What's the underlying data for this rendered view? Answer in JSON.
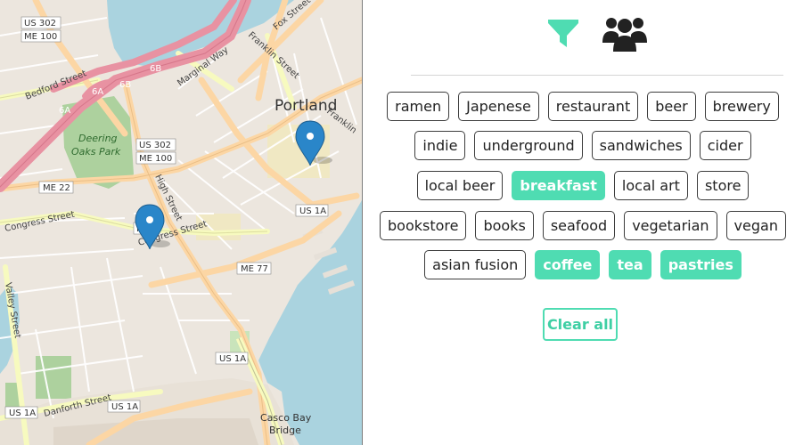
{
  "map": {
    "city_label": "Portland",
    "park_label": "Deering\nOaks Park",
    "bay_label": "Casco Bay\nBridge",
    "shields": {
      "us302_a": "US 302",
      "me100_a": "ME 100",
      "us302_b": "US 302",
      "me100_b": "ME 100",
      "me22": "ME 22",
      "us1a_a": "US 1A",
      "me77": "ME 77",
      "us1a_b": "US 1A",
      "us1a_c": "US 1A",
      "us1a_d": "US 1A",
      "m_box": "ME"
    },
    "exit_labels": {
      "e6a": "6A",
      "e6b": "6B",
      "e6b2": "6B",
      "e6a2": "6A"
    },
    "streets": {
      "bedford": "Bedford Street",
      "marginal": "Marginal Way",
      "franklin_a": "Franklin Street",
      "franklin_b": "Franklin",
      "fox": "Fox Street",
      "high": "High Street",
      "congress_a": "Congress Street",
      "congress_b": "Congress Street",
      "valley": "Valley Street",
      "danforth": "Danforth Street"
    },
    "markers": [
      {
        "name": "marker-downtown"
      },
      {
        "name": "marker-congress"
      }
    ]
  },
  "toolbar": {
    "filter_icon": "filter-icon",
    "people_icon": "users-icon"
  },
  "tags": [
    [
      {
        "label": "ramen",
        "active": false
      },
      {
        "label": "Japenese",
        "active": false
      },
      {
        "label": "restaurant",
        "active": false
      },
      {
        "label": "beer",
        "active": false
      },
      {
        "label": "brewery",
        "active": false
      }
    ],
    [
      {
        "label": "indie",
        "active": false
      },
      {
        "label": "underground",
        "active": false
      },
      {
        "label": "sandwiches",
        "active": false
      },
      {
        "label": "cider",
        "active": false
      }
    ],
    [
      {
        "label": "local beer",
        "active": false
      },
      {
        "label": "breakfast",
        "active": true
      },
      {
        "label": "local art",
        "active": false
      },
      {
        "label": "store",
        "active": false
      }
    ],
    [
      {
        "label": "bookstore",
        "active": false
      },
      {
        "label": "books",
        "active": false
      },
      {
        "label": "seafood",
        "active": false
      },
      {
        "label": "vegetarian",
        "active": false
      },
      {
        "label": "vegan",
        "active": false
      }
    ],
    [
      {
        "label": "asian fusion",
        "active": false
      },
      {
        "label": "coffee",
        "active": true
      },
      {
        "label": "tea",
        "active": true
      },
      {
        "label": "pastries",
        "active": true
      }
    ]
  ],
  "clear_all_label": "Clear all",
  "colors": {
    "accent": "#4fdcb2",
    "marker": "#2a86c9",
    "water": "#aad3df",
    "park": "#add19e",
    "highway": "#e892a2",
    "primary_road": "#fcd6a4",
    "secondary_road": "#f7fabf"
  }
}
